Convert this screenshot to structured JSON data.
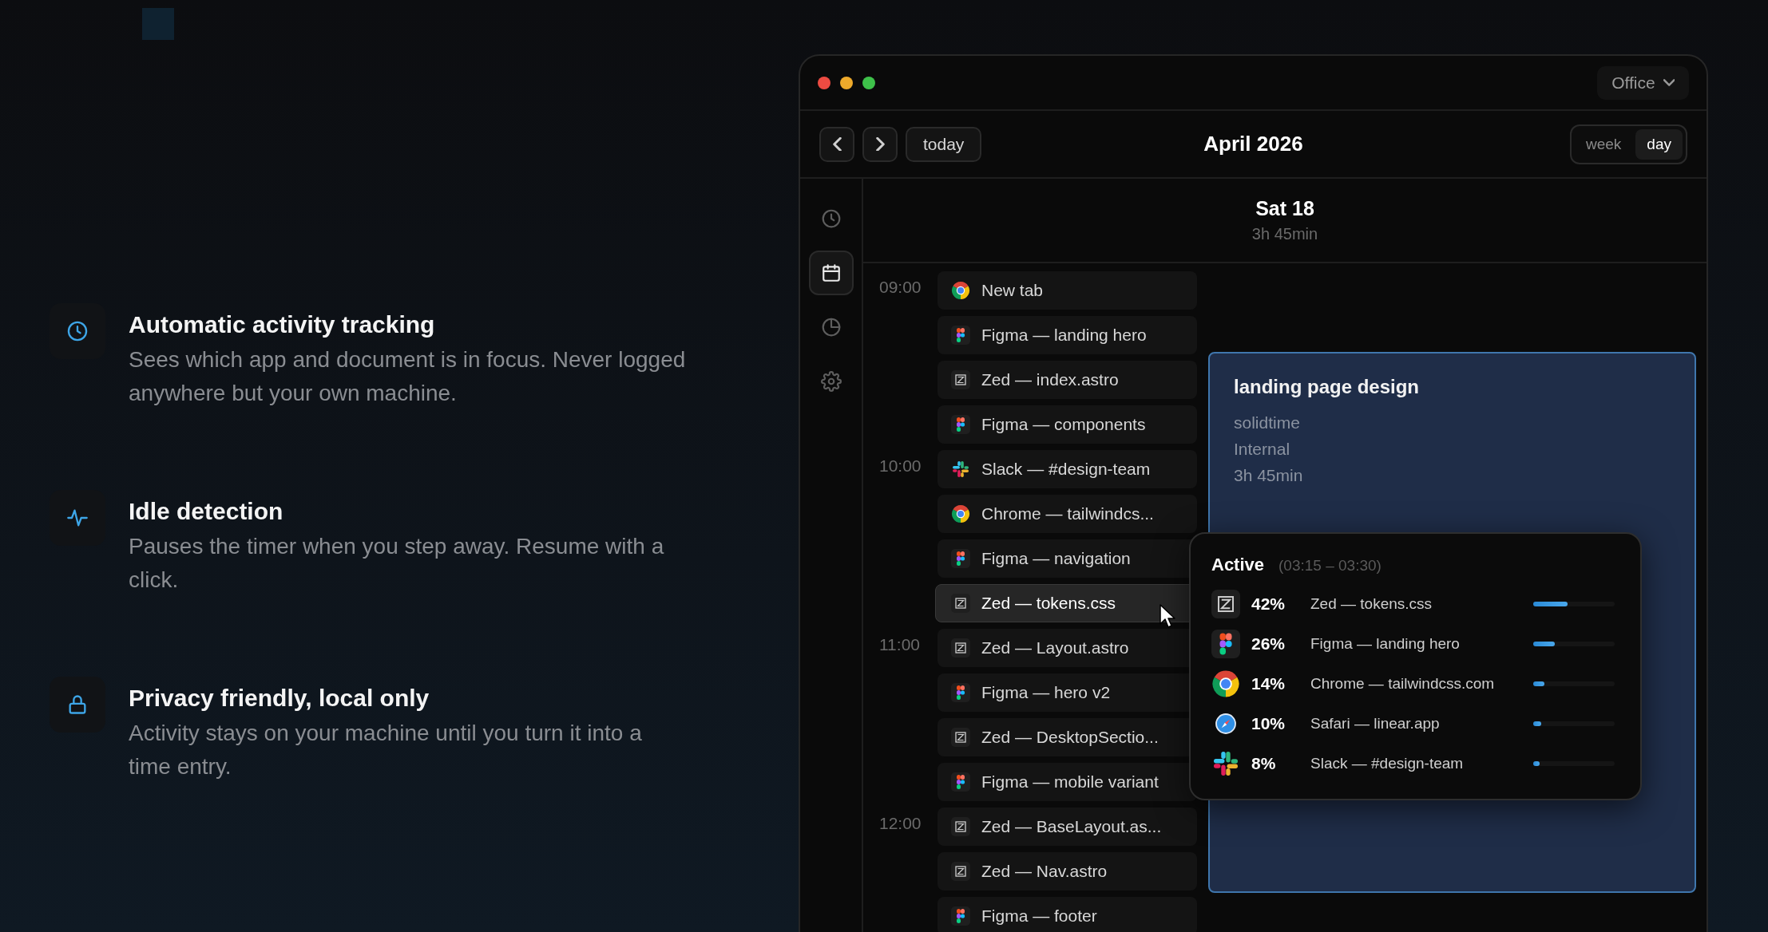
{
  "features": [
    {
      "kind": "clock",
      "title": "Automatic activity tracking",
      "text": "Sees which app and document is in focus. Never logged anywhere but your own machine."
    },
    {
      "kind": "pulse",
      "title": "Idle detection",
      "text": "Pauses the timer when you step away. Resume with a click."
    },
    {
      "kind": "lock",
      "title": "Privacy friendly, local only",
      "text": "Activity stays on your machine until you turn it into a time entry."
    }
  ],
  "window": {
    "workspace": "Office",
    "month": "April 2026",
    "today_button": "today",
    "view_tabs": [
      {
        "label": "week",
        "selected": false
      },
      {
        "label": "day",
        "selected": true
      }
    ],
    "sidebar": [
      {
        "kind": "clock",
        "selected": false
      },
      {
        "kind": "calendar",
        "selected": true
      },
      {
        "kind": "pie",
        "selected": false
      },
      {
        "kind": "gear",
        "selected": false
      }
    ],
    "day": {
      "title": "Sat 18",
      "total": "3h 45min"
    },
    "hours": [
      "09:00",
      "10:00",
      "11:00",
      "12:00"
    ],
    "activities": [
      {
        "kind": "chrome",
        "title": "New tab",
        "selected": false
      },
      {
        "kind": "figma",
        "title": "Figma — landing hero",
        "selected": false
      },
      {
        "kind": "zed",
        "title": "Zed — index.astro",
        "selected": false
      },
      {
        "kind": "figma",
        "title": "Figma — components",
        "selected": false
      },
      {
        "kind": "slack",
        "title": "Slack — #design-team",
        "selected": false
      },
      {
        "kind": "chrome",
        "title": "Chrome — tailwindcs...",
        "selected": false
      },
      {
        "kind": "figma",
        "title": "Figma — navigation",
        "selected": false
      },
      {
        "kind": "zed",
        "title": "Zed — tokens.css",
        "selected": true
      },
      {
        "kind": "zed",
        "title": "Zed — Layout.astro",
        "selected": false
      },
      {
        "kind": "figma",
        "title": "Figma — hero v2",
        "selected": false
      },
      {
        "kind": "zed",
        "title": "Zed — DesktopSectio...",
        "selected": false
      },
      {
        "kind": "figma",
        "title": "Figma — mobile variant",
        "selected": false
      },
      {
        "kind": "zed",
        "title": "Zed — BaseLayout.as...",
        "selected": false
      },
      {
        "kind": "zed",
        "title": "Zed — Nav.astro",
        "selected": false
      },
      {
        "kind": "figma",
        "title": "Figma — footer",
        "selected": false
      }
    ],
    "event": {
      "title": "landing page design",
      "lines": [
        "solidtime",
        "Internal",
        "3h 45min"
      ]
    },
    "popup": {
      "title": "Active",
      "range": "(03:15 – 03:30)",
      "items": [
        {
          "kind": "zed",
          "percent": "42%",
          "name": "Zed — tokens.css",
          "level": 0.42
        },
        {
          "kind": "figma",
          "percent": "26%",
          "name": "Figma — landing hero",
          "level": 0.26
        },
        {
          "kind": "chrome",
          "percent": "14%",
          "name": "Chrome — tailwindcss.com",
          "level": 0.14
        },
        {
          "kind": "safari",
          "percent": "10%",
          "name": "Safari — linear.app",
          "level": 0.1
        },
        {
          "kind": "slack",
          "percent": "8%",
          "name": "Slack — #design-team",
          "level": 0.08
        }
      ]
    }
  }
}
